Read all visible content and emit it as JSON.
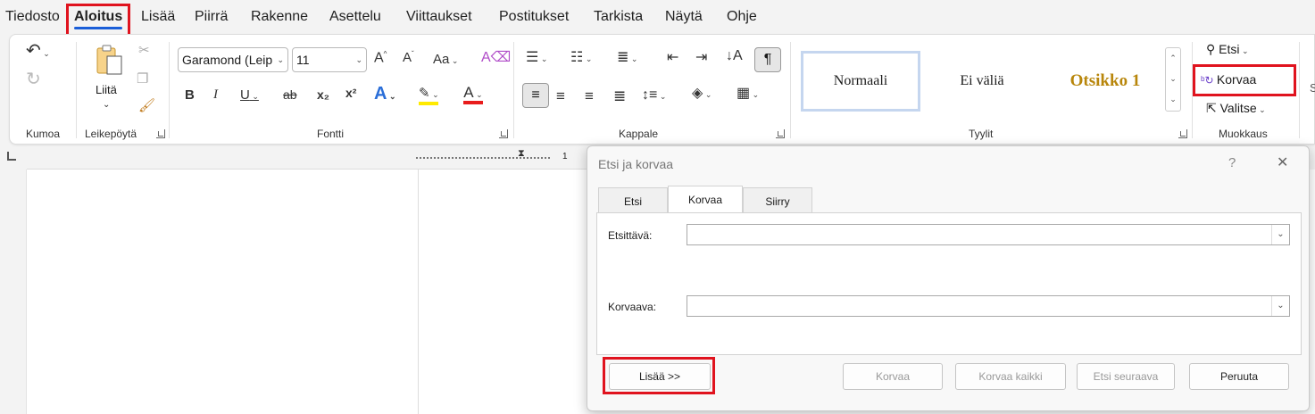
{
  "tabs": [
    "Tiedosto",
    "Aloitus",
    "Lisää",
    "Piirrä",
    "Rakenne",
    "Asettelu",
    "Viittaukset",
    "Postitukset",
    "Tarkista",
    "Näytä",
    "Ohje"
  ],
  "groups": {
    "undo": "Kumoa",
    "clipboard": "Leikepöytä",
    "font": "Fontti",
    "paragraph": "Kappale",
    "styles": "Tyylit",
    "editing": "Muokkaus"
  },
  "clipboard": {
    "paste": "Liitä"
  },
  "font": {
    "name": "Garamond (Leip",
    "size": "11",
    "bold": "B",
    "italic": "I",
    "underline": "U",
    "strike": "ab",
    "sub": "x₂",
    "sup": "x²",
    "grow": "A^",
    "shrink": "Aˇ",
    "case": "Aa",
    "effects": "A",
    "highlight": "ab",
    "color": "A"
  },
  "styles": {
    "items": [
      "Normaali",
      "Ei väliä",
      "Otsikko 1"
    ]
  },
  "editing": {
    "find": "Etsi",
    "replace": "Korvaa",
    "select": "Valitse"
  },
  "ruler": {
    "mark": "1"
  },
  "dialog": {
    "title": "Etsi ja korvaa",
    "help": "?",
    "close": "✕",
    "tabs": [
      "Etsi",
      "Korvaa",
      "Siirry"
    ],
    "find_label": "Etsittävä:",
    "replace_label": "Korvaava:",
    "more": "Lisää >>",
    "replace_btn": "Korvaa",
    "replace_all": "Korvaa kaikki",
    "find_next": "Etsi seuraava",
    "cancel": "Peruuta"
  },
  "colors": {
    "accent": "#1a5ed8",
    "highlight_box": "#e0131e",
    "heading": "#b8860b"
  }
}
